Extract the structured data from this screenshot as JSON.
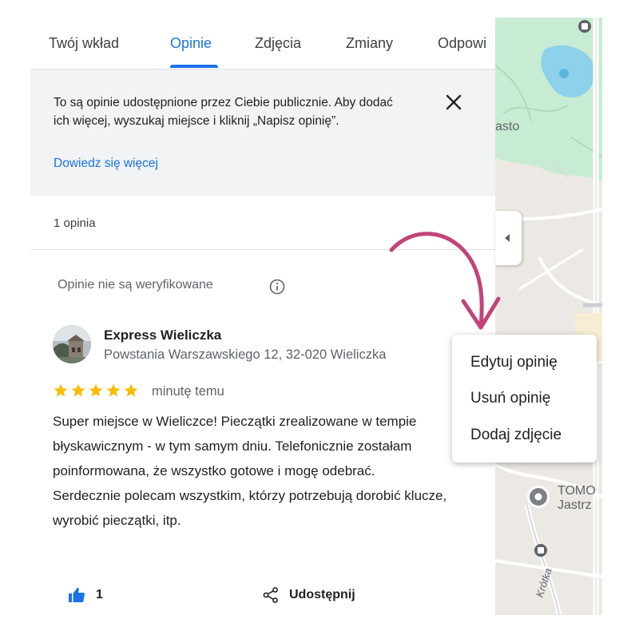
{
  "tabs": [
    {
      "label": "Twój wkład"
    },
    {
      "label": "Opinie"
    },
    {
      "label": "Zdjęcia"
    },
    {
      "label": "Zmiany"
    },
    {
      "label": "Odpowi"
    }
  ],
  "active_tab": "Opinie",
  "banner": {
    "text": "To są opinie udostępnione przez Ciebie publicznie. Aby dodać ich więcej, wyszukaj miejsce i kliknij „Napisz opinię”.",
    "link": "Dowiedz się więcej",
    "close_icon": "close-icon"
  },
  "review_count": "1 opinia",
  "unverified_note": "Opinie nie są weryfikowane",
  "review": {
    "place_name": "Express Wieliczka",
    "address": "Powstania Warszawskiego 12, 32-020 Wieliczka",
    "rating": 5,
    "time": "minutę temu",
    "text": "Super miejsce w Wieliczce! Pieczątki zrealizowane w tempie błyskawicznym - w tym samym dniu. Telefonicznie zostałam poinformowana, że wszystko gotowe i mogę odebrać.\nSerdecznie polecam wszystkim, którzy potrzebują dorobić klucze, wyrobić pieczątki, itp.",
    "likes": "1",
    "share_label": "Udostępnij"
  },
  "context_menu": {
    "items": [
      {
        "label": "Edytuj opinię"
      },
      {
        "label": "Usuń opinię"
      },
      {
        "label": "Dodaj zdjęcie"
      }
    ]
  },
  "map": {
    "labels": {
      "asto": "asto",
      "tomo": "TOMO",
      "jastrz": "Jastrz",
      "krotka": "Krótka"
    }
  },
  "colors": {
    "accent": "#1a73e8",
    "star": "#fbbc04",
    "arrow": "#c2437a",
    "park": "#c8ebd3",
    "water": "#8dd1ea"
  }
}
